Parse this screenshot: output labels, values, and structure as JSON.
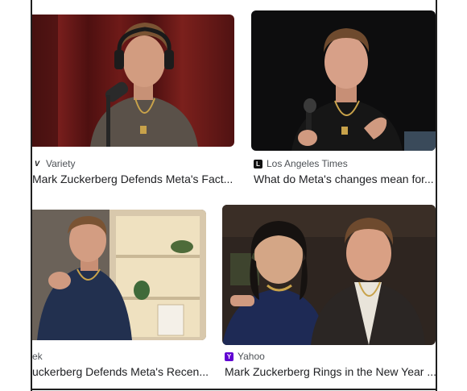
{
  "results": [
    {
      "source": "Variety",
      "favicon": "variety-v-logo-icon",
      "title": "Mark Zuckerberg Defends Meta's Fact..."
    },
    {
      "source": "Los Angeles Times",
      "favicon": "latimes-logo-icon",
      "title": "What do Meta's changes mean for..."
    },
    {
      "source": "ek",
      "favicon": "",
      "title": "uckerberg Defends Meta's Recen..."
    },
    {
      "source": "Yahoo",
      "favicon": "yahoo-logo-icon",
      "title": "Mark Zuckerberg Rings in the New Year ..."
    }
  ],
  "colors": {
    "text_primary": "#202124",
    "text_secondary": "#4d5156",
    "yahoo_purple": "#6001d2"
  }
}
